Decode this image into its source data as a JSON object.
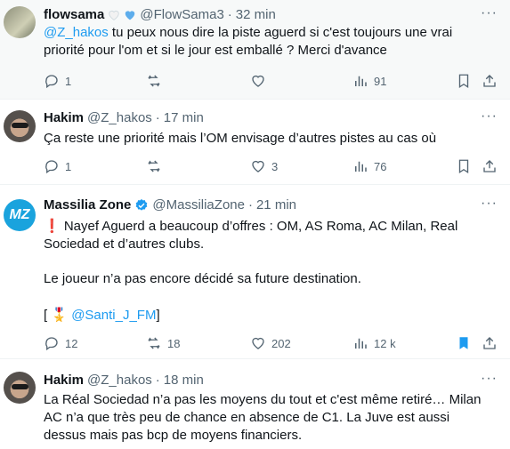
{
  "tweets": [
    {
      "name": "flowsama",
      "handle": "@FlowSama3",
      "time": "32 min",
      "text_mention": "@Z_hakos",
      "text": " tu peux nous dire la piste aguerd si c'est toujours une vrai priorité pour l'om et si le jour est emballé ? Merci d'avance",
      "replies": "1",
      "retweets": "",
      "likes": "",
      "views": "91"
    },
    {
      "name": "Hakim",
      "handle": "@Z_hakos",
      "time": "17 min",
      "text": "Ça reste une priorité mais l’OM envisage d’autres pistes au cas où",
      "replies": "1",
      "retweets": "",
      "likes": "3",
      "views": "76"
    },
    {
      "name": "Massilia Zone",
      "handle": "@MassiliaZone",
      "time": "21 min",
      "avatar_text": "MZ",
      "text_line1": "❗ Nayef Aguerd a beaucoup d’offres : OM, AS Roma, AC Milan, Real Sociedad et d’autres clubs.",
      "text_line2": "Le joueur n’a pas encore décidé sa future destination.",
      "text_open": "[ ",
      "text_emoji": "🎖️ ",
      "text_mention": "@Santi_J_FM",
      "text_close": "]",
      "replies": "12",
      "retweets": "18",
      "likes": "202",
      "views": "12 k"
    },
    {
      "name": "Hakim",
      "handle": "@Z_hakos",
      "time": "18 min",
      "text": "La Réal Sociedad n’a pas les moyens du tout et c'est même retiré… Milan AC n’a que très peu de chance en absence de C1. La Juve est aussi dessus mais pas bcp de moyens financiers."
    }
  ],
  "separator": "·",
  "more_label": "···",
  "colors": {
    "accent": "#1d9bf0",
    "muted": "#536471",
    "highlight_bg": "#f7f9f9"
  }
}
